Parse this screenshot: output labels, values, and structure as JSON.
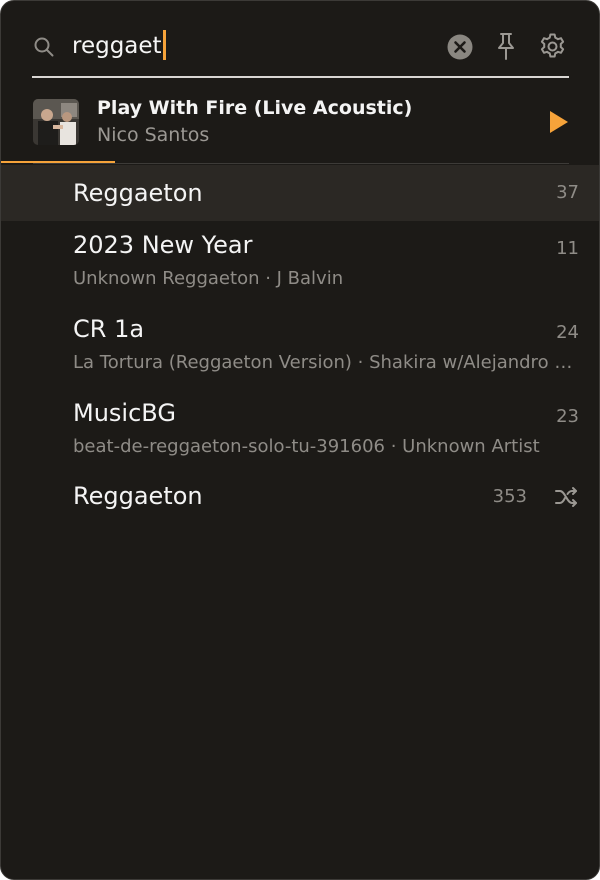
{
  "search": {
    "query": "reggaet",
    "icons": {
      "search": "search-icon",
      "clear": "clear-icon",
      "pin": "pin-icon",
      "settings": "gear-icon"
    }
  },
  "now_playing": {
    "title": "Play With Fire (Live Acoustic)",
    "artist": "Nico Santos",
    "progress": 0.19,
    "play_icon": "play-icon"
  },
  "results": [
    {
      "title": "Reggaeton",
      "subtitle": "",
      "count": "37",
      "selected": true
    },
    {
      "title": "2023 New Year",
      "subtitle": "Unknown Reggaeton · J Balvin",
      "count": "11"
    },
    {
      "title": "CR 1a",
      "subtitle": "La Tortura (Reggaeton Version) · Shakira w/Alejandro Sanz",
      "count": "24"
    },
    {
      "title": "MusicBG",
      "subtitle": "beat-de-reggaeton-solo-tu-391606 · Unknown Artist",
      "count": "23"
    },
    {
      "title": "Reggaeton",
      "subtitle": "",
      "count": "353",
      "icon": "shuffle-icon"
    }
  ],
  "colors": {
    "background": "#1c1a17",
    "accent": "#f6a33a",
    "selected_row": "#2b2824",
    "primary_text": "#f4f4f4",
    "secondary_text": "#8f8c87"
  }
}
